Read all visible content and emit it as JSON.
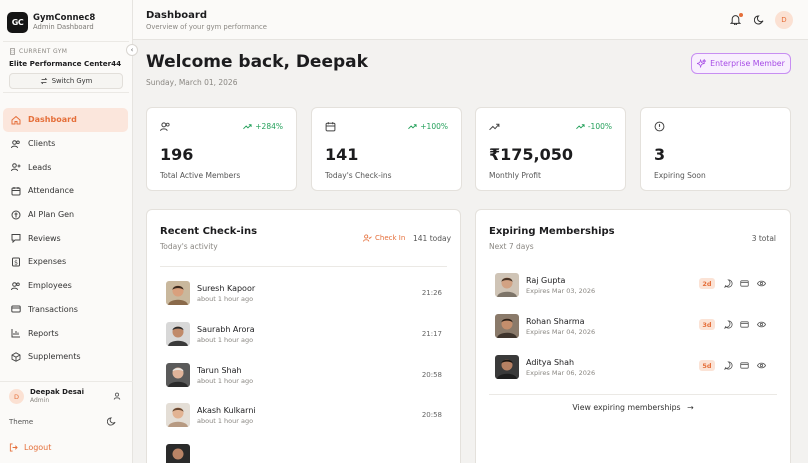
{
  "brand": {
    "logo_text": "GC",
    "name": "GymConnec8",
    "subtitle": "Admin Dashboard"
  },
  "gym": {
    "label": "CURRENT GYM",
    "name": "Elite Performance Center44",
    "switch_label": "Switch Gym"
  },
  "nav": [
    {
      "label": "Dashboard",
      "icon": "home-icon",
      "active": true
    },
    {
      "label": "Clients",
      "icon": "users-icon"
    },
    {
      "label": "Leads",
      "icon": "user-plus-icon"
    },
    {
      "label": "Attendance",
      "icon": "calendar-icon"
    },
    {
      "label": "AI Plan Gen",
      "icon": "ai-icon"
    },
    {
      "label": "Reviews",
      "icon": "message-icon"
    },
    {
      "label": "Expenses",
      "icon": "dollar-icon"
    },
    {
      "label": "Employees",
      "icon": "employees-icon"
    },
    {
      "label": "Transactions",
      "icon": "card-icon"
    },
    {
      "label": "Reports",
      "icon": "chart-icon"
    },
    {
      "label": "Supplements",
      "icon": "box-icon"
    }
  ],
  "user": {
    "initial": "D",
    "name": "Deepak Desai",
    "role": "Admin"
  },
  "theme_label": "Theme",
  "logout_label": "Logout",
  "header": {
    "title": "Dashboard",
    "subtitle": "Overview of your gym performance",
    "avatar_initial": "D"
  },
  "welcome": "Welcome back, Deepak",
  "date": "Sunday, March 01, 2026",
  "enterprise_label": "Enterprise Member",
  "stats": [
    {
      "icon": "users-icon",
      "trend": "+284%",
      "value": "196",
      "label": "Total Active Members"
    },
    {
      "icon": "calendar-icon",
      "trend": "+100%",
      "value": "141",
      "label": "Today's Check-ins"
    },
    {
      "icon": "trending-up-icon",
      "trend": "-100%",
      "value": "₹175,050",
      "label": "Monthly Profit"
    },
    {
      "icon": "clock-icon",
      "trend": "",
      "value": "3",
      "label": "Expiring Soon"
    }
  ],
  "checkins": {
    "title": "Recent Check-ins",
    "subtitle": "Today's activity",
    "checkin_label": "Check In",
    "count_label": "141 today",
    "items": [
      {
        "name": "Suresh Kapoor",
        "ago": "about 1 hour ago",
        "time": "21:26"
      },
      {
        "name": "Saurabh Arora",
        "ago": "about 1 hour ago",
        "time": "21:17"
      },
      {
        "name": "Tarun Shah",
        "ago": "about 1 hour ago",
        "time": "20:58"
      },
      {
        "name": "Akash Kulkarni",
        "ago": "about 1 hour ago",
        "time": "20:58"
      }
    ]
  },
  "expiring": {
    "title": "Expiring Memberships",
    "subtitle": "Next 7 days",
    "total_label": "3 total",
    "view_label": "View expiring memberships",
    "items": [
      {
        "name": "Raj Gupta",
        "expires": "Expires Mar 03, 2026",
        "days": "2d"
      },
      {
        "name": "Rohan Sharma",
        "expires": "Expires Mar 04, 2026",
        "days": "3d"
      },
      {
        "name": "Aditya Shah",
        "expires": "Expires Mar 06, 2026",
        "days": "5d"
      }
    ]
  },
  "colors": {
    "accent": "#e56f3a",
    "trend_green": "#23a05a",
    "enterprise": "#a64be6"
  }
}
